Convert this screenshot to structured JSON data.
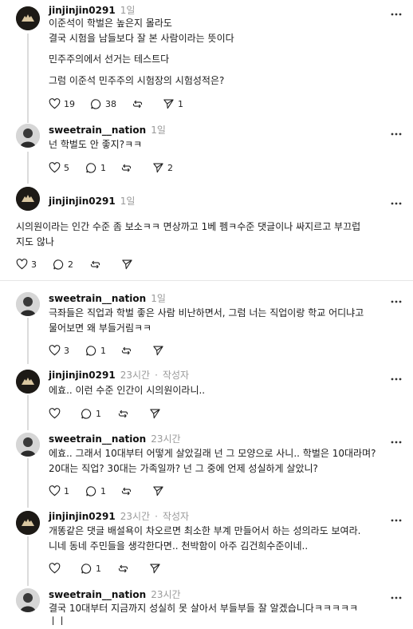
{
  "comments": [
    {
      "user": "jinjinjin0291",
      "time": "1일",
      "badge": "",
      "lines": [
        "이준석이 학벌은 높은지 몰라도",
        "결국 시험을 남들보다 잘 본 사람이라는 뜻이다",
        "민주주의에서 선거는 테스트다",
        "그럼 이준석 민주주의 시험장의 시험성적은?"
      ],
      "likes": "19",
      "replies": "38",
      "reposts": "",
      "shares": "1"
    },
    {
      "user": "sweetrain__nation",
      "time": "1일",
      "badge": "",
      "lines": [
        "넌 학벌도 안 좋지?ㅋㅋ"
      ],
      "likes": "5",
      "replies": "1",
      "reposts": "",
      "shares": "2"
    },
    {
      "user": "jinjinjin0291",
      "time": "1일",
      "badge": "",
      "lines": [
        "시의원이라는 인간 수준 좀 보소ㅋㅋ 면상까고 1베 펨ㅋ수준 댓글이나 싸지르고 부끄럽",
        "지도 않나"
      ],
      "likes": "3",
      "replies": "2",
      "reposts": "",
      "shares": ""
    },
    {
      "user": "sweetrain__nation",
      "time": "1일",
      "badge": "",
      "lines": [
        "극좌들은 직업과 학벌 좋은 사람 비난하면서, 그럼 너는 직업이랑 학교 어디냐고",
        "물어보면 왜 부들거림ㅋㅋ"
      ],
      "likes": "3",
      "replies": "1",
      "reposts": "",
      "shares": ""
    },
    {
      "user": "jinjinjin0291",
      "time": "23시간",
      "badge": "작성자",
      "lines": [
        "에효.. 이런 수준 인간이 시의원이라니.."
      ],
      "likes": "",
      "replies": "1",
      "reposts": "",
      "shares": ""
    },
    {
      "user": "sweetrain__nation",
      "time": "23시간",
      "badge": "",
      "lines": [
        "에효.. 그래서 10대부터 어떻게 살았길래 넌 그 모양으로 사니.. 학벌은 10대라며?",
        "20대는 직업? 30대는 가족일까? 넌 그 중에 언제 성실하게 살았니?"
      ],
      "likes": "1",
      "replies": "1",
      "reposts": "",
      "shares": ""
    },
    {
      "user": "jinjinjin0291",
      "time": "23시간",
      "badge": "작성자",
      "lines": [
        "개똥같은 댓글 배설욕이 차오르면 최소한 부계 만들어서 하는 성의라도 보여라.",
        "니네 동네 주민들을 생각한다면.. 천박함이 아주 김건희수준이네.."
      ],
      "likes": "",
      "replies": "1",
      "reposts": "",
      "shares": ""
    },
    {
      "user": "sweetrain__nation",
      "time": "23시간",
      "badge": "",
      "lines": [
        "결국 10대부터 지금까지 성실히 못 살아서 부들부들 잘 알겠습니다ㅋㅋㅋㅋㅋ",
        "ㅣㅣ"
      ],
      "likes": "",
      "replies": "",
      "reposts": "",
      "shares": ""
    }
  ],
  "meta_separator": "·",
  "icons": [
    "heart-icon",
    "comment-icon",
    "repost-icon",
    "share-icon",
    "more-icon"
  ]
}
